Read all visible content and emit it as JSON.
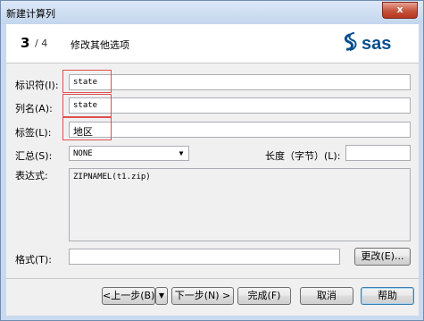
{
  "window": {
    "title": "新建计算列",
    "close_label": "x"
  },
  "header": {
    "step_current": "3",
    "step_sep": "/ 4",
    "step_title": "修改其他选项",
    "logo_text": "sas"
  },
  "form": {
    "identifier_label": "标识符(I):",
    "identifier_value": "state",
    "column_name_label": "列名(A):",
    "column_name_value": "state",
    "tag_label": "标签(L):",
    "tag_value": "地区",
    "summary_label": "汇总(S):",
    "summary_value": "NONE",
    "length_label": "长度（字节）(L):",
    "length_value": "",
    "expression_label": "表达式:",
    "expression_value": "ZIPNAMEL(t1.zip)",
    "format_label": "格式(T):",
    "format_value": "",
    "change_button": "更改(E)..."
  },
  "footer": {
    "prev_button": "<上一步(B)",
    "next_button": "下一步(N) >",
    "finish_button": "完成(F)",
    "cancel_button": "取消",
    "help_button": "帮助"
  },
  "colors": {
    "highlight_box": "#e05050",
    "sas_blue": "#0a4e8c"
  }
}
